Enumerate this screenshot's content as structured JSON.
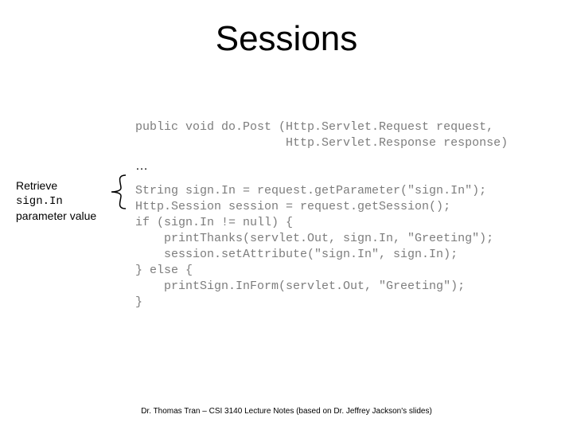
{
  "title": "Sessions",
  "ellipsis": "…",
  "annotation": {
    "line1": "Retrieve",
    "line2": "sign.In",
    "line3": "parameter value"
  },
  "code": {
    "l1": "public void do.Post (Http.Servlet.Request request,",
    "l2": "                     Http.Servlet.Response response)",
    "l3": "String sign.In = request.getParameter(\"sign.In\");",
    "l4": "Http.Session session = request.getSession();",
    "l5": "if (sign.In != null) {",
    "l6": "    printThanks(servlet.Out, sign.In, \"Greeting\");",
    "l7": "    session.setAttribute(\"sign.In\", sign.In);",
    "l8": "} else {",
    "l9": "    printSign.InForm(servlet.Out, \"Greeting\");",
    "l10": "}"
  },
  "footer": "Dr. Thomas Tran – CSI 3140 Lecture Notes (based on Dr. Jeffrey Jackson's slides)"
}
